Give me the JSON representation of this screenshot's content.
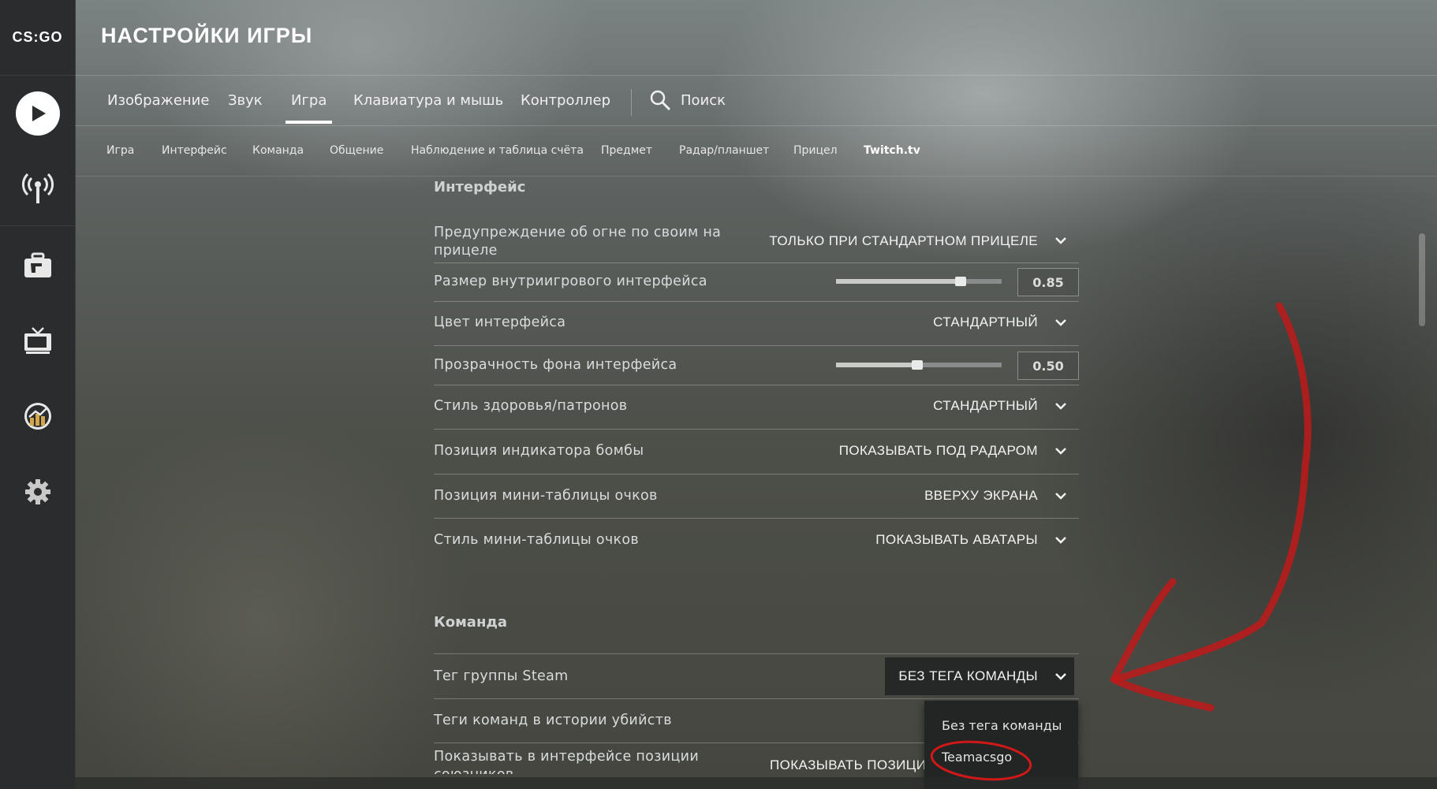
{
  "app": {
    "logo_text": "CS:GO",
    "page_title": "НАСТРОЙКИ ИГРЫ"
  },
  "rail": [
    {
      "icon": "play-icon"
    },
    {
      "icon": "broadcast-icon"
    },
    {
      "icon": "briefcase-icon"
    },
    {
      "icon": "tv-icon"
    },
    {
      "icon": "stats-icon"
    },
    {
      "icon": "gear-icon"
    }
  ],
  "tabs": [
    {
      "label": "Изображение"
    },
    {
      "label": "Звук"
    },
    {
      "label": "Игра",
      "active": true
    },
    {
      "label": "Клавиатура и мышь"
    },
    {
      "label": "Контроллер"
    }
  ],
  "search": {
    "label": "Поиск"
  },
  "subtabs": [
    {
      "label": "Игра"
    },
    {
      "label": "Интерфейс"
    },
    {
      "label": "Команда"
    },
    {
      "label": "Общение"
    },
    {
      "label": "Наблюдение и таблица счёта"
    },
    {
      "label": "Предмет"
    },
    {
      "label": "Радар/планшет"
    },
    {
      "label": "Прицел"
    },
    {
      "label": "Twitch.tv",
      "active": true
    }
  ],
  "interface": {
    "title": "Интерфейс",
    "rows": [
      {
        "label": "Предупреждение об огне по своим на прицеле",
        "value": "ТОЛЬКО ПРИ СТАНДАРТНОМ ПРИЦЕЛЕ"
      },
      {
        "label": "Размер внутриигрового интерфейса",
        "value": "0.85",
        "level": 0.8
      },
      {
        "label": "Цвет интерфейса",
        "value": "СТАНДАРТНЫЙ"
      },
      {
        "label": "Прозрачность фона интерфейса",
        "value": "0.50",
        "level": 0.5
      },
      {
        "label": "Стиль здоровья/патронов",
        "value": "СТАНДАРТНЫЙ"
      },
      {
        "label": "Позиция индикатора бомбы",
        "value": "ПОКАЗЫВАТЬ ПОД РАДАРОМ"
      },
      {
        "label": "Позиция мини-таблицы очков",
        "value": "ВВЕРХУ ЭКРАНА"
      },
      {
        "label": "Стиль мини-таблицы очков",
        "value": "ПОКАЗЫВАТЬ АВАТАРЫ"
      }
    ]
  },
  "team": {
    "title": "Команда",
    "rows": [
      {
        "label": "Тег группы Steam",
        "value": "БЕЗ ТЕГА КОМАНДЫ"
      },
      {
        "label": "Теги команд в истории убийств",
        "value": ""
      },
      {
        "label": "Показывать в интерфейсе позиции союзников",
        "value": "ПОКАЗЫВАТЬ ПОЗИЦИИ"
      }
    ],
    "dropdown_options": [
      {
        "label": "Без тега команды"
      },
      {
        "label": "Teamacsgo"
      }
    ]
  },
  "colors": {
    "rail_bg": "#2a2c2d",
    "dropdown_bg": "#232525",
    "annotation_red": "#c01a1a"
  }
}
